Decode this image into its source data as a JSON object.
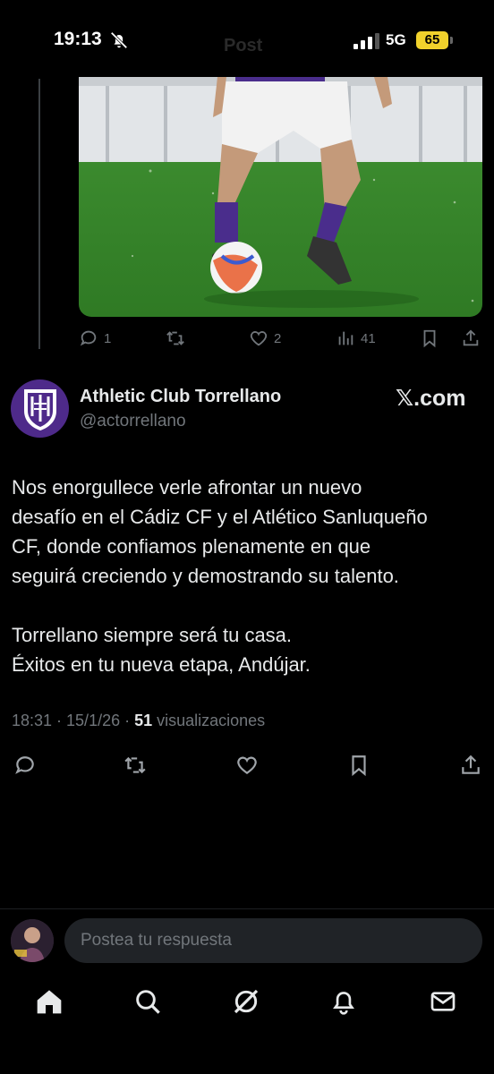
{
  "status_bar": {
    "time": "19:13",
    "faded_title": "Post",
    "network": "5G",
    "battery": "65",
    "icons": [
      "bell-off-icon",
      "signal-icon"
    ]
  },
  "previous_post": {
    "media_description_icon": "soccer-photo",
    "actions": {
      "replies": "1",
      "likes": "2",
      "views": "41"
    }
  },
  "post": {
    "author_name": "Athletic Club Torrellano",
    "author_handle": "@actorrellano",
    "source_badge": "𝕏.com",
    "paragraph_1_line_1": "Nos enorgullece verle afrontar un nuevo",
    "paragraph_1_line_2": "desafío en el Cádiz CF y el Atlético Sanluqueño",
    "paragraph_1_line_3": "CF, donde confiamos plenamente en que",
    "paragraph_1_line_4": "seguirá creciendo y demostrando su talento.",
    "paragraph_2_line_1": "Torrellano siempre será tu casa.",
    "paragraph_2_line_2": "Éxitos en tu nueva etapa, Andújar.",
    "timestamp": "18:31 · 15/1/26 · ",
    "views_count": "51",
    "views_label": " visualizaciones"
  },
  "reply": {
    "placeholder": "Postea tu respuesta"
  },
  "bottom_nav": [
    "home-icon",
    "search-icon",
    "grok-icon",
    "notifications-icon",
    "messages-icon"
  ],
  "colors": {
    "background": "#000000",
    "text": "#e7e9ea",
    "muted": "#71767b",
    "battery": "#f1d22c",
    "club_purple": "#4e2a8a"
  }
}
